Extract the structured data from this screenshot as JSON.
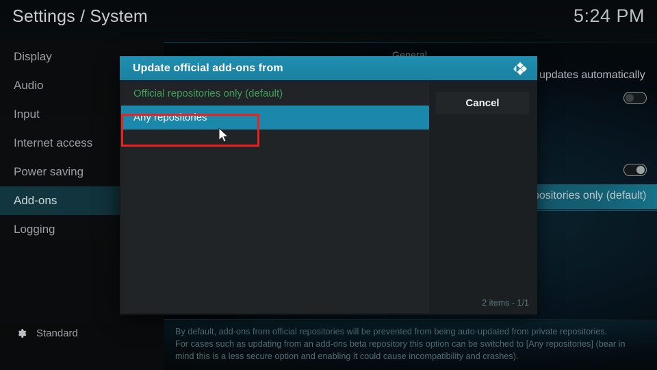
{
  "header": {
    "title": "Settings / System",
    "clock": "5:24 PM"
  },
  "sidebar": {
    "items": [
      {
        "label": "Display",
        "active": false
      },
      {
        "label": "Audio",
        "active": false
      },
      {
        "label": "Input",
        "active": false
      },
      {
        "label": "Internet access",
        "active": false
      },
      {
        "label": "Power saving",
        "active": false
      },
      {
        "label": "Add-ons",
        "active": true
      },
      {
        "label": "Logging",
        "active": false
      }
    ],
    "profile": {
      "icon": "gear-icon",
      "label": "Standard"
    }
  },
  "settings_panel": {
    "section_header": "General",
    "partial_setting_label": "l updates automatically",
    "toggles": [
      {
        "name": "updates-automatically-toggle",
        "state": "off"
      },
      {
        "name": "unknown-sources-toggle",
        "state": "on"
      }
    ],
    "selected_row_text": "positories only (default)"
  },
  "dialog": {
    "title": "Update official add-ons from",
    "logo": "kodi-logo",
    "options": [
      {
        "label": "Official repositories only (default)",
        "state": "current-value"
      },
      {
        "label": "Any repositories",
        "state": "focused"
      }
    ],
    "cancel_label": "Cancel",
    "items_count": "2 items - 1/1"
  },
  "description": {
    "line1": "By default, add-ons from official repositories will be prevented from being auto-updated from private repositories.",
    "line2": "For cases such as updating from an add-ons beta repository this option can be switched to [Any repositories] (bear in",
    "line3": "mind this is a less secure option and enabling it could cause incompatibility and crashes)."
  },
  "annotation": {
    "name": "red-highlight-box",
    "color": "#ee2020"
  },
  "colors": {
    "accent": "#1a87ab",
    "header_blue": "#1d87a8",
    "value_green": "#3f9f5c",
    "sidebar_active": "#12363f",
    "description_text": "#4f6f74"
  }
}
